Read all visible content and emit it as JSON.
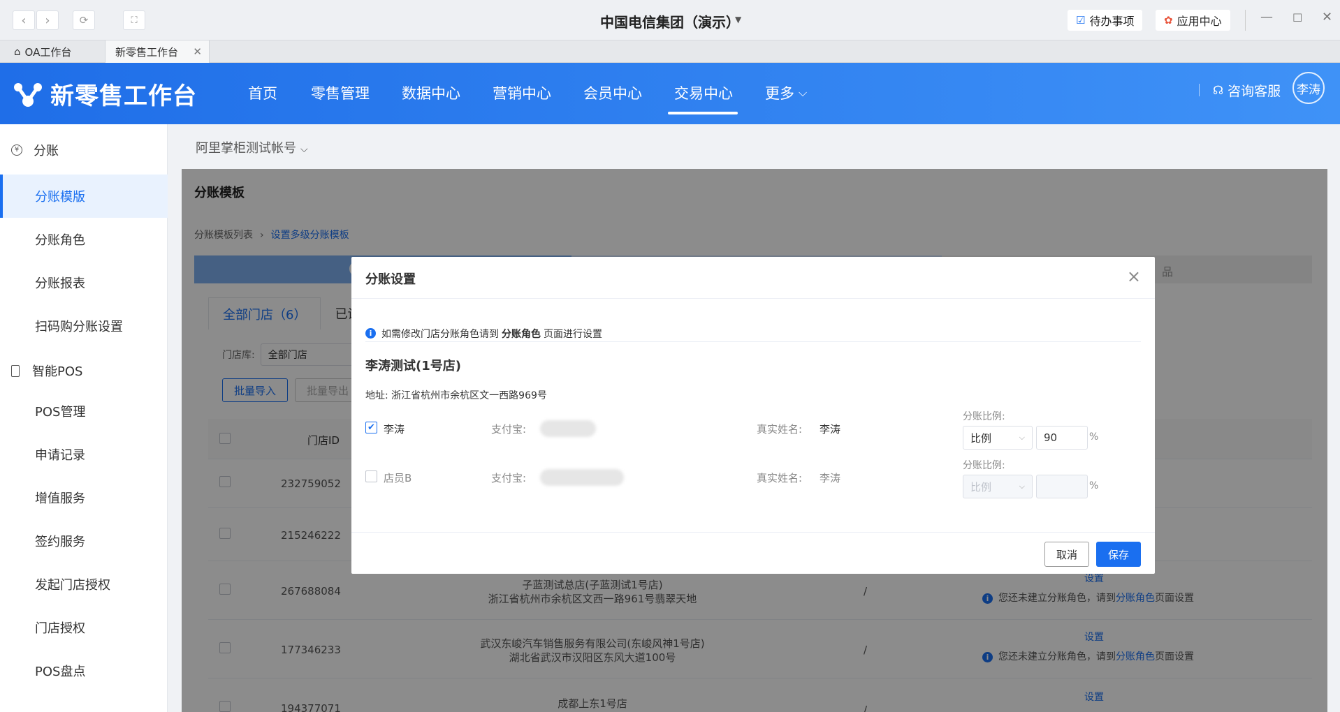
{
  "window": {
    "title": "中国电信集团（演示）",
    "todo_label": "待办事项",
    "app_center_label": "应用中心"
  },
  "tabs": [
    {
      "label": "OA工作台"
    },
    {
      "label": "新零售工作台"
    }
  ],
  "header": {
    "brand": "新零售工作台",
    "nav": [
      "首页",
      "零售管理",
      "数据中心",
      "营销中心",
      "会员中心",
      "交易中心",
      "更多"
    ],
    "active_nav": "交易中心",
    "consult_label": "咨询客服",
    "avatar_text": "李涛"
  },
  "sidebar": {
    "group1": "分账",
    "group1_items": [
      "分账模版",
      "分账角色",
      "分账报表",
      "扫码购分账设置"
    ],
    "group2": "智能POS",
    "group2_items": [
      "POS管理",
      "申请记录",
      "增值服务",
      "签约服务",
      "发起门店授权",
      "门店授权",
      "POS盘点"
    ]
  },
  "account": "阿里掌柜测试帐号",
  "page": {
    "title": "分账模板",
    "breadcrumb": [
      "分账模板列表",
      "设置多级分账模板"
    ],
    "step3_partial": "品",
    "tabs": [
      "全部门店（6）",
      "已设"
    ],
    "filter_label": "门店库:",
    "filter_value": "全部门店",
    "btn_import": "批量导入",
    "btn_export": "批量导出",
    "table_headers": [
      "门店ID"
    ],
    "rows": [
      {
        "id": "232759052"
      },
      {
        "id": "215246222"
      },
      {
        "id": "267688084",
        "name": "子蓝测试总店(子蓝测试1号店)",
        "addr": "浙江省杭州市余杭区文西一路961号翡翠天地",
        "dash": "/",
        "action": "设置",
        "note_pre": "您还未建立分账角色，请到",
        "note_link": "分账角色",
        "note_post": "页面设置"
      },
      {
        "id": "177346233",
        "name": "武汉东峻汽车销售服务有限公司(东峻风神1号店)",
        "addr": "湖北省武汉市汉阳区东风大道100号",
        "dash": "/",
        "action": "设置",
        "note_pre": "您还未建立分账角色，请到",
        "note_link": "分账角色",
        "note_post": "页面设置"
      },
      {
        "id": "194377071",
        "name": "成都上东1号店",
        "dash": "/",
        "action": "设置"
      }
    ]
  },
  "modal": {
    "title": "分账设置",
    "tip_pre": "如需修改门店分账角色请到",
    "tip_link": "分账角色",
    "tip_post": "页面进行设置",
    "store_name": "李涛测试(1号店)",
    "address": "地址: 浙江省杭州市余杭区文一西路969号",
    "members": [
      {
        "name": "李涛",
        "checked": true,
        "alipay_label": "支付宝:",
        "real_name_label": "真实姓名:",
        "real_name": "李涛",
        "ratio_label": "分账比例:",
        "ratio_type": "比例",
        "ratio_value": "90",
        "pct": "%"
      },
      {
        "name": "店员B",
        "checked": false,
        "alipay_label": "支付宝:",
        "real_name_label": "真实姓名:",
        "real_name": "李涛",
        "ratio_label": "分账比例:",
        "ratio_type": "比例",
        "ratio_value": "",
        "pct": "%"
      }
    ],
    "cancel_label": "取消",
    "save_label": "保存"
  }
}
